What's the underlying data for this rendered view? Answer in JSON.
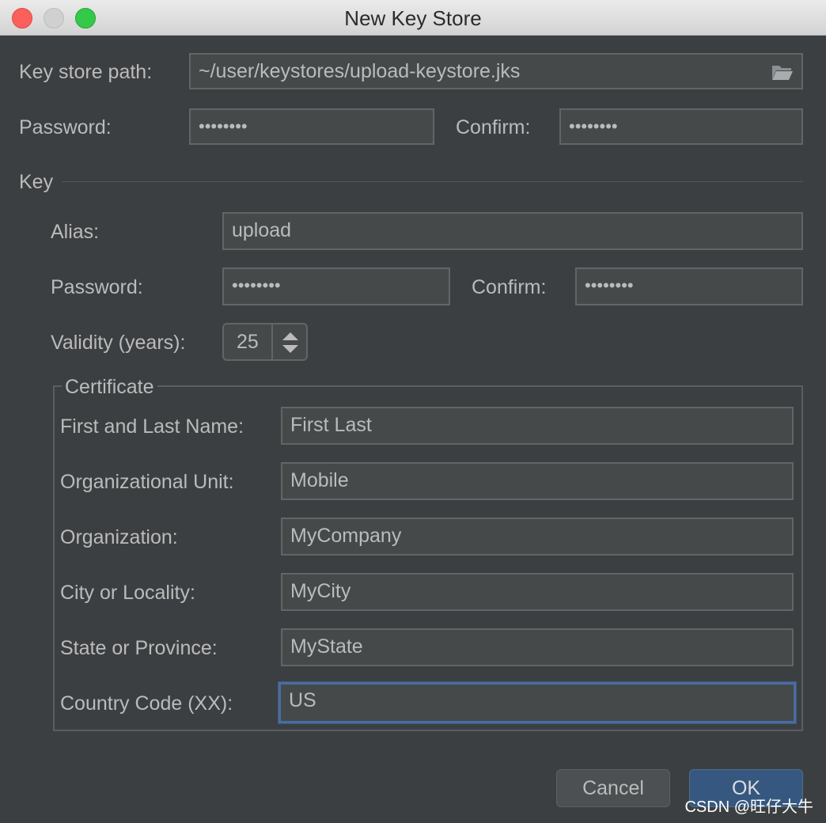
{
  "window": {
    "title": "New Key Store"
  },
  "keystore": {
    "path_label": "Key store path:",
    "path_value": "~/user/keystores/upload-keystore.jks",
    "password_label": "Password:",
    "password_value": "••••••••",
    "confirm_label": "Confirm:",
    "confirm_value": "••••••••"
  },
  "key": {
    "section_label": "Key",
    "alias_label": "Alias:",
    "alias_value": "upload",
    "password_label": "Password:",
    "password_value": "••••••••",
    "confirm_label": "Confirm:",
    "confirm_value": "••••••••",
    "validity_label": "Validity (years):",
    "validity_value": "25"
  },
  "certificate": {
    "legend": "Certificate",
    "name_label": "First and Last Name:",
    "name_value": "First Last",
    "unit_label": "Organizational Unit:",
    "unit_value": "Mobile",
    "org_label": "Organization:",
    "org_value": "MyCompany",
    "city_label": "City or Locality:",
    "city_value": "MyCity",
    "state_label": "State or Province:",
    "state_value": "MyState",
    "country_label": "Country Code (XX):",
    "country_value": "US"
  },
  "buttons": {
    "cancel": "Cancel",
    "ok": "OK"
  },
  "watermark": "CSDN @旺仔大牛",
  "colors": {
    "background": "#3c3f41",
    "field": "#45494a",
    "accent": "#365880",
    "focus": "#4a6da1"
  }
}
